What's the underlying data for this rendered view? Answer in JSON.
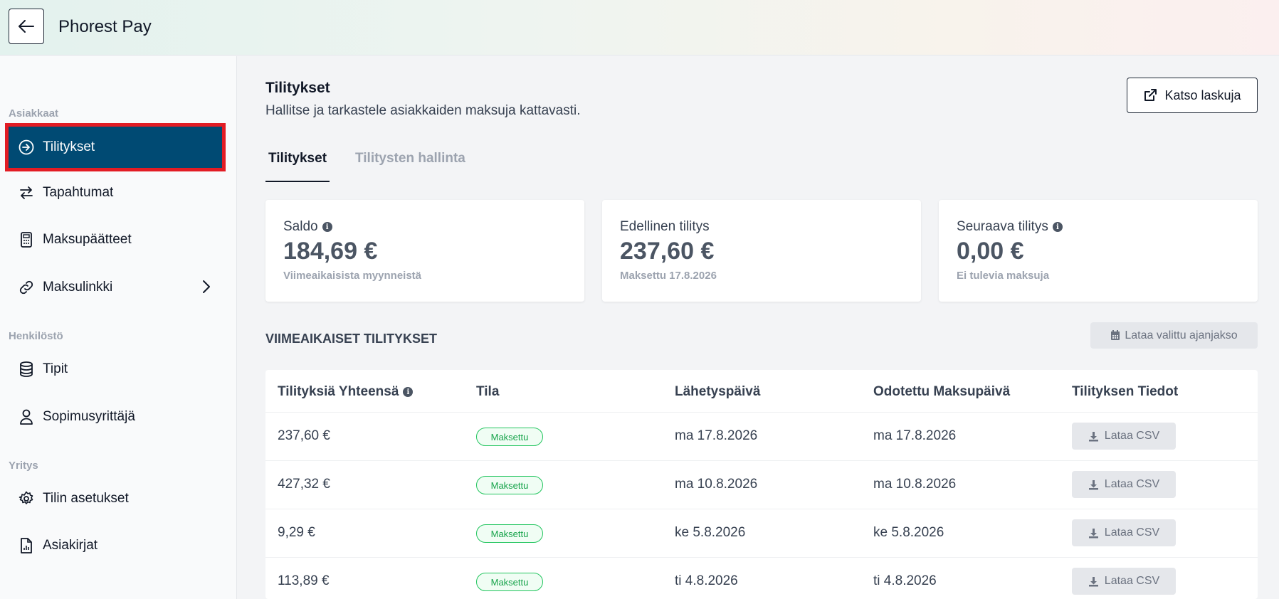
{
  "app": {
    "title": "Phorest Pay"
  },
  "sidebar": {
    "sections": [
      {
        "label": "Asiakkaat"
      },
      {
        "label": "Henkilöstö"
      },
      {
        "label": "Yritys"
      }
    ],
    "items": [
      {
        "label": "Tilitykset",
        "icon": "arrow-circle-right-icon",
        "active": true
      },
      {
        "label": "Tapahtumat",
        "icon": "swap-arrows-icon"
      },
      {
        "label": "Maksupäätteet",
        "icon": "calculator-icon"
      },
      {
        "label": "Maksulinkki",
        "icon": "link-icon"
      },
      {
        "label": "Tipit",
        "icon": "database-icon"
      },
      {
        "label": "Sopimusyrittäjä",
        "icon": "user-icon"
      },
      {
        "label": "Tilin asetukset",
        "icon": "gear-icon"
      },
      {
        "label": "Asiakirjat",
        "icon": "document-chart-icon"
      }
    ]
  },
  "main": {
    "title": "Tilitykset",
    "subtitle": "Hallitse ja tarkastele asiakkaiden maksuja kattavasti.",
    "invoice_button": "Katso laskuja",
    "tabs": [
      {
        "label": "Tilitykset",
        "active": true
      },
      {
        "label": "Tilitysten hallinta",
        "active": false
      }
    ],
    "cards": [
      {
        "label": "Saldo",
        "value": "184,69 €",
        "note": "Viimeaikaisista myynneistä",
        "info": true
      },
      {
        "label": "Edellinen tilitys",
        "value": "237,60 €",
        "note": "Maksettu 17.8.2026",
        "info": false
      },
      {
        "label": "Seuraava tilitys",
        "value": "0,00 €",
        "note": "Ei tulevia maksuja",
        "info": true
      }
    ],
    "recent_title": "VIIMEAIKAISET TILITYKSET",
    "download_period_button": "Lataa valittu ajanjakso",
    "table": {
      "headers": [
        "Tilityksiä Yhteensä",
        "Tila",
        "Lähetyspäivä",
        "Odotettu Maksupäivä",
        "Tilityksen Tiedot"
      ],
      "rows": [
        {
          "total": "237,60 €",
          "status": "Maksettu",
          "sent": "ma 17.8.2026",
          "expected": "ma 17.8.2026",
          "action": "Lataa CSV"
        },
        {
          "total": "427,32 €",
          "status": "Maksettu",
          "sent": "ma 10.8.2026",
          "expected": "ma 10.8.2026",
          "action": "Lataa CSV"
        },
        {
          "total": "9,29 €",
          "status": "Maksettu",
          "sent": "ke 5.8.2026",
          "expected": "ke 5.8.2026",
          "action": "Lataa CSV"
        },
        {
          "total": "113,89 €",
          "status": "Maksettu",
          "sent": "ti 4.8.2026",
          "expected": "ti 4.8.2026",
          "action": "Lataa CSV"
        }
      ]
    }
  },
  "colors": {
    "active_nav": "#004a73",
    "highlight_outline": "#e21c24",
    "status_green": "#16a34a"
  }
}
